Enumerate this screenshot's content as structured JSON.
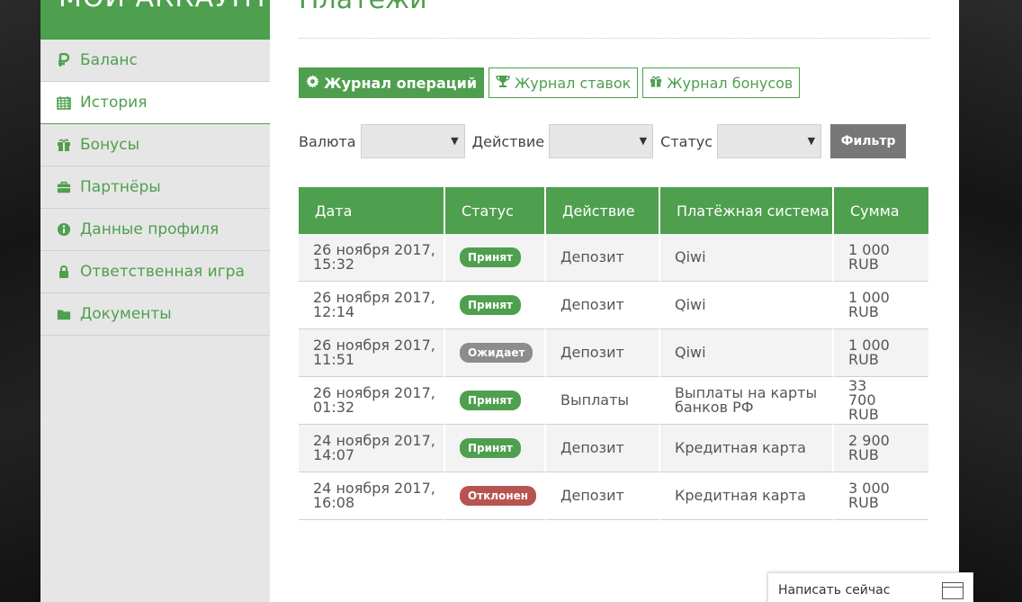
{
  "sidebar": {
    "title": "МОЙ АККАУНТ",
    "items": [
      {
        "label": "Баланс",
        "icon": "ruble-icon",
        "active": false
      },
      {
        "label": "История",
        "icon": "calendar-icon",
        "active": true
      },
      {
        "label": "Бонусы",
        "icon": "gift-icon",
        "active": false
      },
      {
        "label": "Партнёры",
        "icon": "briefcase-icon",
        "active": false
      },
      {
        "label": "Данные профиля",
        "icon": "info-icon",
        "active": false
      },
      {
        "label": "Ответственная игра",
        "icon": "lock-icon",
        "active": false
      },
      {
        "label": "Документы",
        "icon": "folder-icon",
        "active": false
      }
    ]
  },
  "main": {
    "title": "Платежи",
    "tabs": [
      {
        "label": "Журнал операций",
        "icon": "gear-icon",
        "active": true
      },
      {
        "label": "Журнал ставок",
        "icon": "trophy-icon",
        "active": false
      },
      {
        "label": "Журнал бонусов",
        "icon": "gift-icon",
        "active": false
      }
    ],
    "filters": {
      "currency_label": "Валюта",
      "currency_value": "",
      "action_label": "Действие",
      "action_value": "",
      "status_label": "Статус",
      "status_value": "",
      "filter_button": "Фильтр"
    },
    "table": {
      "headers": [
        "Дата",
        "Статус",
        "Действие",
        "Платёжная система",
        "Сумма"
      ],
      "rows": [
        {
          "date": "26 ноября 2017, 15:32",
          "status": "Принят",
          "action": "Депозит",
          "system": "Qiwi",
          "sum": "1 000 RUB"
        },
        {
          "date": "26 ноября 2017, 12:14",
          "status": "Принят",
          "action": "Депозит",
          "system": "Qiwi",
          "sum": "1 000 RUB"
        },
        {
          "date": "26 ноября 2017, 11:51",
          "status": "Ожидает",
          "action": "Депозит",
          "system": "Qiwi",
          "sum": "1 000 RUB"
        },
        {
          "date": "26 ноября 2017, 01:32",
          "status": "Принят",
          "action": "Выплаты",
          "system": "Выплаты на карты банков РФ",
          "sum": "33 700 RUB"
        },
        {
          "date": "24 ноября 2017, 14:07",
          "status": "Принят",
          "action": "Депозит",
          "system": "Кредитная карта",
          "sum": "2 900 RUB"
        },
        {
          "date": "24 ноября 2017, 16:08",
          "status": "Отклонен",
          "action": "Депозит",
          "system": "Кредитная карта",
          "sum": "3 000 RUB"
        }
      ]
    }
  },
  "status_colors": {
    "Принят": "#4e9f4e",
    "Ожидает": "#8c8c8c",
    "Отклонен": "#b85450"
  },
  "accent_color": "#4e9f4e",
  "chat": {
    "label": "Написать сейчас"
  }
}
